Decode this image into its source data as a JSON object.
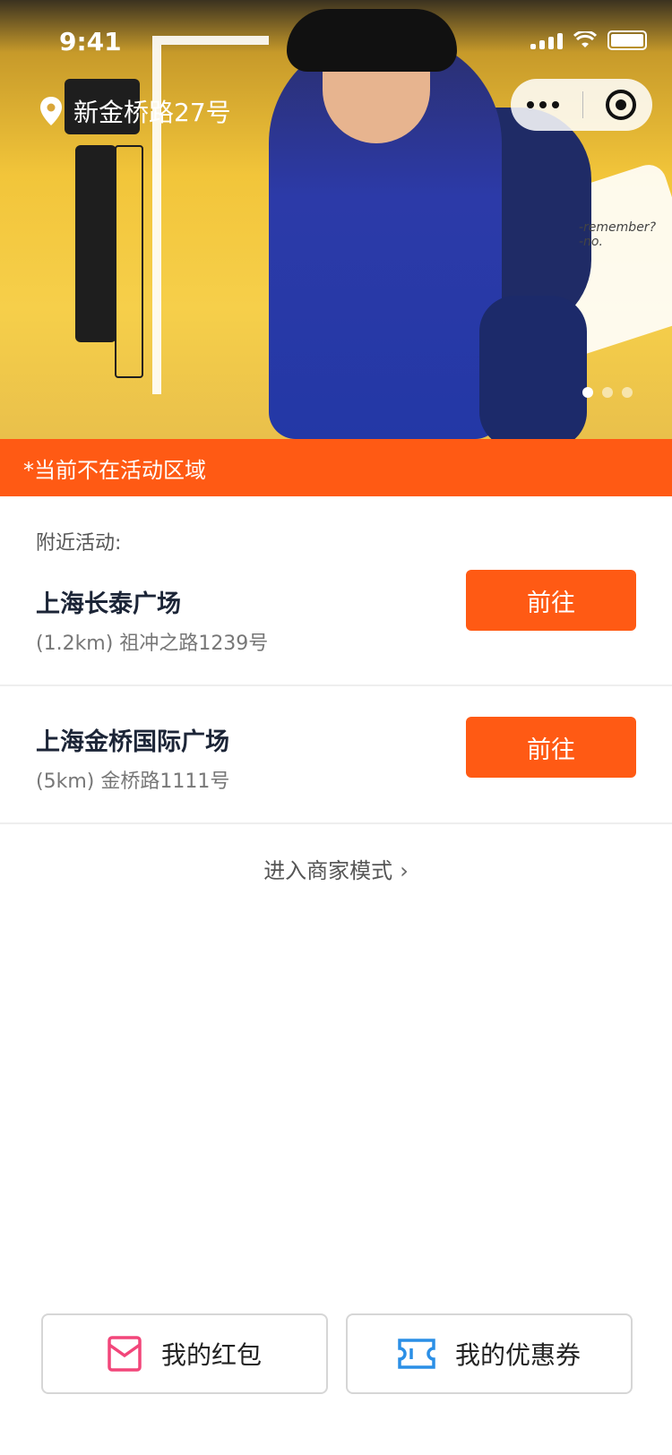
{
  "status_bar": {
    "time": "9:41"
  },
  "header": {
    "location": "新金桥路27号",
    "location_icon": "location-pin-icon",
    "capsule_icons": [
      "more-dots-icon",
      "target-icon"
    ]
  },
  "banner": {
    "decor_text": [
      "-remember?",
      "-no."
    ],
    "pager": {
      "total": 3,
      "active": 0
    }
  },
  "notice": {
    "text": "*当前不在活动区域",
    "color": "#ff5a14"
  },
  "nearby": {
    "label": "附近活动:",
    "items": [
      {
        "name": "上海长泰广场",
        "address": "(1.2km) 祖冲之路1239号",
        "button": "前往"
      },
      {
        "name": "上海金桥国际广场",
        "address": "(5km) 金桥路1111号",
        "button": "前往"
      }
    ]
  },
  "merchant_link": {
    "label": "进入商家模式",
    "icon": "chevron-right-icon"
  },
  "bottom": {
    "red_packet": {
      "label": "我的红包",
      "icon": "red-envelope-icon",
      "icon_color": "#f2467a"
    },
    "coupons": {
      "label": "我的优惠券",
      "icon": "coupon-ticket-icon",
      "icon_color": "#2b8fe6"
    }
  },
  "colors": {
    "accent": "#ff5a14",
    "title": "#1c2537"
  }
}
